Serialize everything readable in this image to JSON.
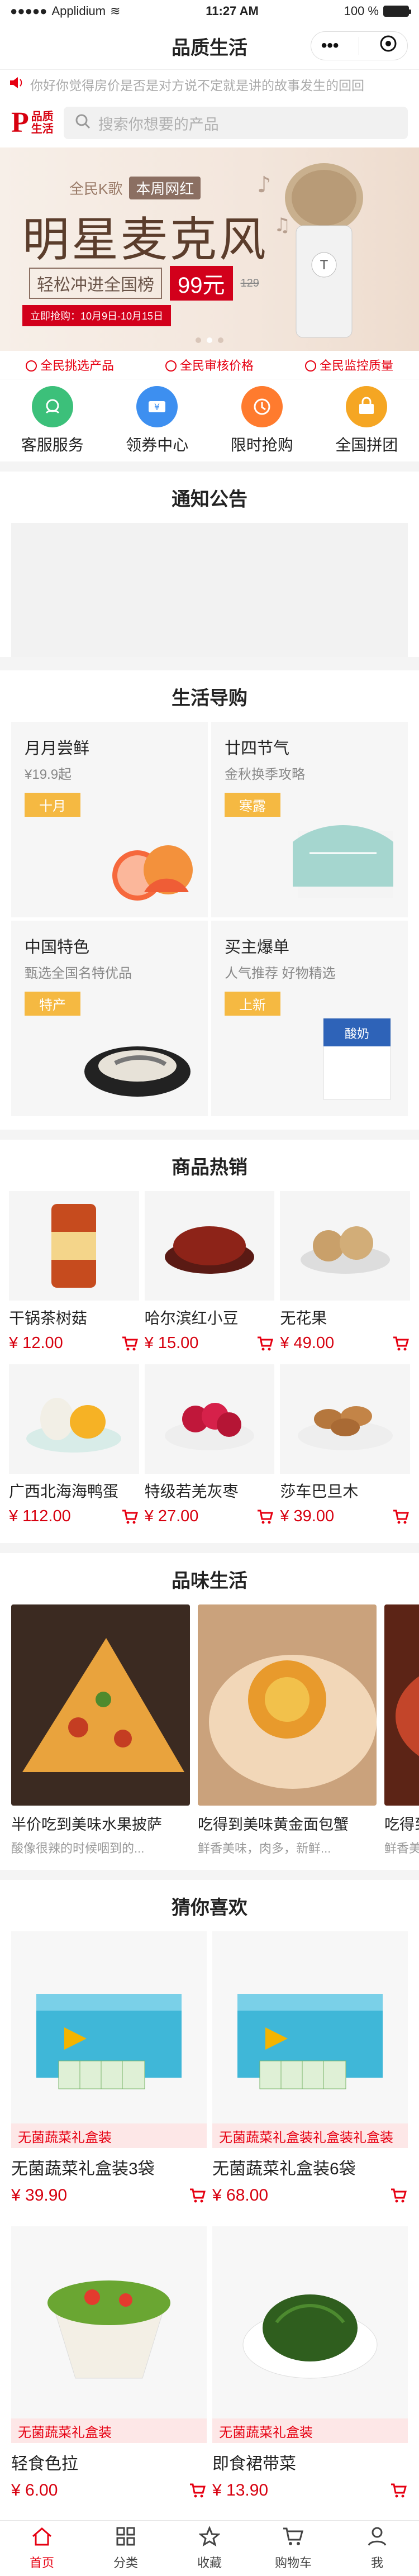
{
  "status_bar": {
    "carrier": "Applidium",
    "time": "11:27 AM",
    "battery": "100 %",
    "battery_level": 1.0
  },
  "nav": {
    "title": "品质生活",
    "more_icon": "more-dots-icon",
    "close_icon": "target-icon"
  },
  "notice": {
    "text": "你好你觉得房价是否是对方说不定就是讲的故事发生的回回"
  },
  "header": {
    "logo_text": "品质生活",
    "search_placeholder": "搜索你想要的产品"
  },
  "banner": {
    "kicker": "全民K歌",
    "kicker_tag": "本周网红",
    "title": "明星麦克风",
    "subtitle": "轻松冲进全国榜",
    "price": "99元",
    "old_price": "129",
    "date": "立即抢购：10月9日-10月15日",
    "slide_count": 3,
    "active_slide": 1
  },
  "guarantees": [
    "全民挑选产品",
    "全民审核价格",
    "全民监控质量"
  ],
  "quick_menu": [
    {
      "label": "客服服务",
      "color": "#3cc07a",
      "icon": "customer-service-icon"
    },
    {
      "label": "领券中心",
      "color": "#3d8ff0",
      "icon": "coupon-icon"
    },
    {
      "label": "限时抢购",
      "color": "#ff7b2e",
      "icon": "clock-icon"
    },
    {
      "label": "全国拼团",
      "color": "#f5a623",
      "icon": "group-buy-icon"
    }
  ],
  "sections": {
    "notice_title": "通知公告",
    "guide_title": "生活导购",
    "hot_title": "商品热销",
    "taste_title": "品味生活",
    "guess_title": "猜你喜欢"
  },
  "guide": [
    {
      "title": "月月尝鲜",
      "desc": "¥19.9起",
      "tag": "十月"
    },
    {
      "title": "廿四节气",
      "desc": "金秋换季攻略",
      "tag": "寒露"
    },
    {
      "title": "中国特色",
      "desc": "甄选全国名特优品",
      "tag": "特产"
    },
    {
      "title": "买主爆单",
      "desc": "人气推荐 好物精选",
      "tag": "上新"
    }
  ],
  "hot_products": [
    {
      "name": "干锅茶树菇",
      "price": "¥ 12.00"
    },
    {
      "name": "哈尔滨红小豆",
      "price": "¥ 15.00"
    },
    {
      "name": "无花果",
      "price": "¥ 49.00"
    },
    {
      "name": "广西北海海鸭蛋",
      "price": "¥ 112.00"
    },
    {
      "name": "特级若羌灰枣",
      "price": "¥ 27.00"
    },
    {
      "name": "莎车巴旦木",
      "price": "¥ 39.00"
    }
  ],
  "taste": [
    {
      "name": "半价吃到美味水果披萨",
      "desc": "酸像很辣的时候咽到的..."
    },
    {
      "name": "吃得到美味黄金面包蟹",
      "desc": "鲜香美味，肉多，新鲜..."
    },
    {
      "name": "吃得到",
      "desc": "鲜香美味"
    }
  ],
  "guess": [
    {
      "label": "无菌蔬菜礼盒装",
      "name": "无菌蔬菜礼盒装3袋",
      "price": "¥ 39.90"
    },
    {
      "label": "无菌蔬菜礼盒装礼盒装礼盒装",
      "name": "无菌蔬菜礼盒装6袋",
      "price": "¥ 68.00"
    },
    {
      "label": "无菌蔬菜礼盒装",
      "name": "轻食色拉",
      "price": "¥ 6.00"
    },
    {
      "label": "无菌蔬菜礼盒装",
      "name": "即食裙带菜",
      "price": "¥ 13.90"
    }
  ],
  "tabs": [
    {
      "label": "首页",
      "icon": "home-icon",
      "active": true
    },
    {
      "label": "分类",
      "icon": "category-icon",
      "active": false
    },
    {
      "label": "收藏",
      "icon": "star-icon",
      "active": false
    },
    {
      "label": "购物车",
      "icon": "cart-icon",
      "active": false
    },
    {
      "label": "我",
      "icon": "user-icon",
      "active": false
    }
  ]
}
